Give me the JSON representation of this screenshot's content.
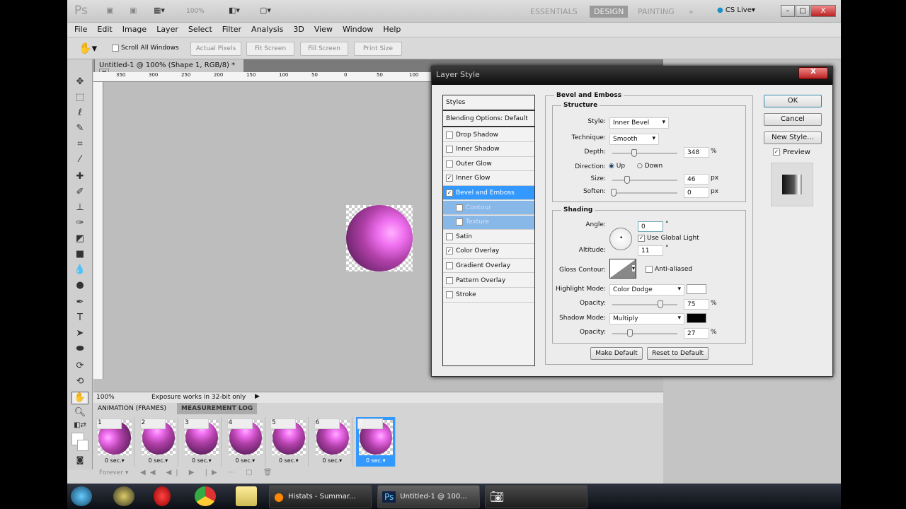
{
  "app": {
    "logo": "Ps",
    "zoom": "100%",
    "workspaces": [
      "ESSENTIALS",
      "DESIGN",
      "PAINTING"
    ],
    "active_workspace": "DESIGN",
    "more": "»",
    "cs_live": "CS Live"
  },
  "menu": [
    "File",
    "Edit",
    "Image",
    "Layer",
    "Select",
    "Filter",
    "Analysis",
    "3D",
    "View",
    "Window",
    "Help"
  ],
  "options": {
    "scroll_all": "Scroll All Windows",
    "buttons": [
      "Actual Pixels",
      "Fit Screen",
      "Fill Screen",
      "Print Size"
    ]
  },
  "document": {
    "tab": "Untitled-1 @ 100% (Shape 1, RGB/8) *",
    "ruler": [
      "350",
      "300",
      "250",
      "200",
      "150",
      "100",
      "50",
      "0",
      "50",
      "100"
    ],
    "zoom": "100%",
    "status": "Exposure works in 32-bit only"
  },
  "animation": {
    "tabs": [
      "ANIMATION (FRAMES)",
      "MEASUREMENT LOG"
    ],
    "frames": [
      {
        "n": "1",
        "d": "0 sec."
      },
      {
        "n": "2",
        "d": "0 sec."
      },
      {
        "n": "3",
        "d": "0 sec."
      },
      {
        "n": "4",
        "d": "0 sec."
      },
      {
        "n": "5",
        "d": "0 sec."
      },
      {
        "n": "6",
        "d": "0 sec."
      },
      {
        "n": "7",
        "d": "0 sec."
      }
    ],
    "selected_frame": 7,
    "loop": "Forever"
  },
  "dialog": {
    "title": "Layer Style",
    "close": "X",
    "styles_header": "Styles",
    "blending": "Blending Options: Default",
    "effects": [
      {
        "label": "Drop Shadow",
        "checked": false
      },
      {
        "label": "Inner Shadow",
        "checked": false
      },
      {
        "label": "Outer Glow",
        "checked": false
      },
      {
        "label": "Inner Glow",
        "checked": true
      },
      {
        "label": "Bevel and Emboss",
        "checked": true
      },
      {
        "label": "Contour",
        "checked": false
      },
      {
        "label": "Texture",
        "checked": false
      },
      {
        "label": "Satin",
        "checked": false
      },
      {
        "label": "Color Overlay",
        "checked": true
      },
      {
        "label": "Gradient Overlay",
        "checked": false
      },
      {
        "label": "Pattern Overlay",
        "checked": false
      },
      {
        "label": "Stroke",
        "checked": false
      }
    ],
    "section": "Bevel and Emboss",
    "structure": "Structure",
    "shading": "Shading",
    "style_label": "Style:",
    "style": "Inner Bevel",
    "technique_label": "Technique:",
    "technique": "Smooth",
    "depth_label": "Depth:",
    "depth": "348",
    "pct": "%",
    "direction_label": "Direction:",
    "up": "Up",
    "down": "Down",
    "direction": "Up",
    "size_label": "Size:",
    "size": "46",
    "px": "px",
    "soften_label": "Soften:",
    "soften": "0",
    "angle_label": "Angle:",
    "angle": "0",
    "deg": "°",
    "global_light": "Use Global Light",
    "altitude_label": "Altitude:",
    "altitude": "11",
    "gloss_label": "Gloss Contour:",
    "anti_aliased": "Anti-aliased",
    "highlight_label": "Highlight Mode:",
    "highlight": "Color Dodge",
    "highlight_color": "#ffffff",
    "opacity_label": "Opacity:",
    "highlight_opacity": "75",
    "shadow_label": "Shadow Mode:",
    "shadow": "Multiply",
    "shadow_color": "#000000",
    "shadow_opacity": "27",
    "make_default": "Make Default",
    "reset_default": "Reset to Default",
    "ok": "OK",
    "cancel": "Cancel",
    "new_style": "New Style...",
    "preview": "Preview"
  },
  "taskbar": {
    "tasks": [
      "Histats - Summar...",
      "Untitled-1 @ 100..."
    ]
  }
}
